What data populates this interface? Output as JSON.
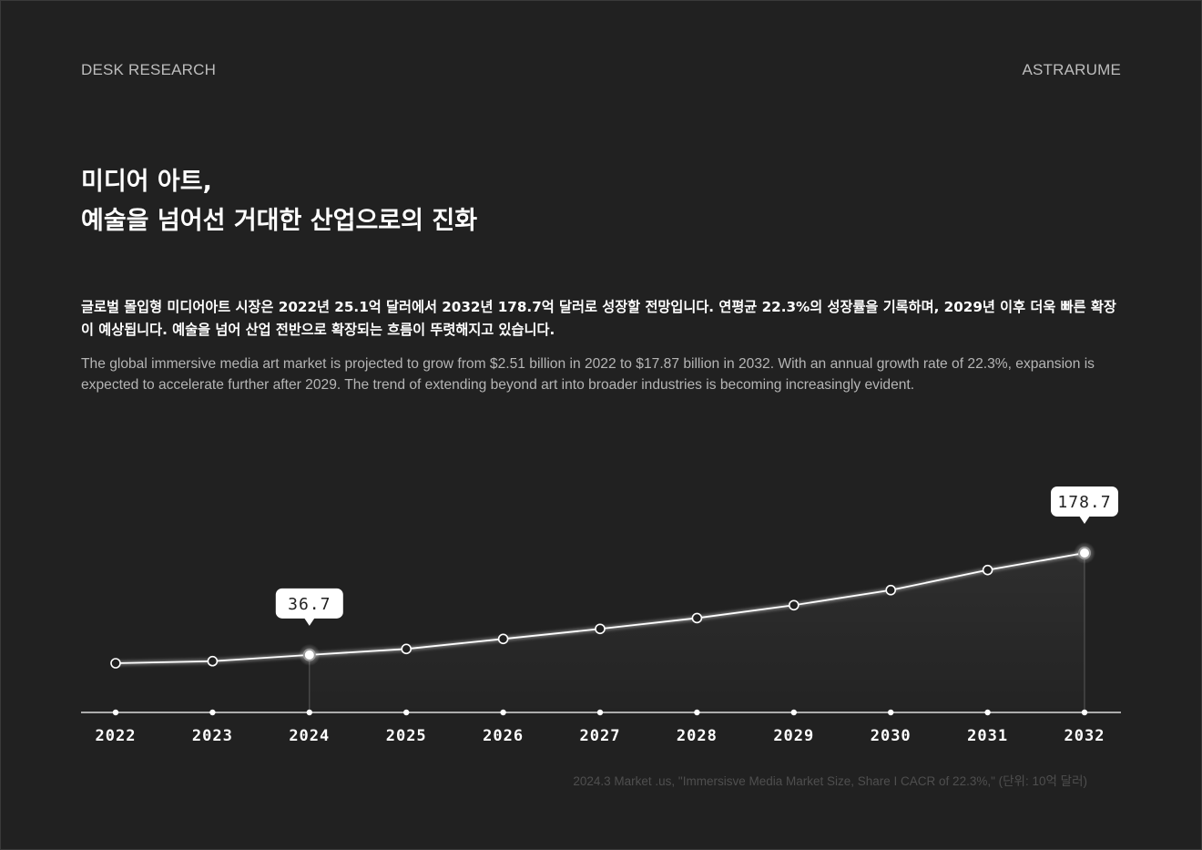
{
  "header": {
    "left_label": "DESK RESEARCH",
    "right_label": "ASTRARUME"
  },
  "title": {
    "line1": "미디어 아트,",
    "line2": "예술을 넘어선 거대한 산업으로의 진화"
  },
  "description": {
    "korean": "글로벌 몰입형 미디어아트 시장은 2022년 25.1억 달러에서 2032년 178.7억 달러로 성장할 전망입니다. 연평균 22.3%의 성장률을 기록하며, 2029년 이후 더욱 빠른 확장이 예상됩니다. 예술을 넘어 산업 전반으로 확장되는 흐름이 뚜렷해지고 있습니다.",
    "english": "The global immersive media art market is projected to grow from $2.51 billion in 2022 to $17.87 billion in 2032. With an annual growth rate of 22.3%, expansion is expected to accelerate further after 2029. The trend of extending beyond art into broader industries is becoming increasingly evident."
  },
  "source": "2024.3 Market .us, \"Immersisve Media Market Size, Share I CACR of 22.3%,\"   (단위: 10억 달러)",
  "colors": {
    "background": "#212121",
    "line": "#ffffff",
    "tick_label": "#ffffff",
    "callout_bg": "#ffffff",
    "callout_text": "#222222"
  },
  "chart_data": {
    "type": "line",
    "categories": [
      "2022",
      "2023",
      "2024",
      "2025",
      "2026",
      "2027",
      "2028",
      "2029",
      "2030",
      "2031",
      "2032"
    ],
    "values": [
      25.1,
      28.0,
      36.7,
      45.0,
      59.0,
      73.0,
      88.0,
      106.0,
      127.0,
      155.0,
      178.7
    ],
    "highlights": [
      {
        "category": "2024",
        "label": "36.7"
      },
      {
        "category": "2032",
        "label": "178.7"
      }
    ],
    "xlabel": "",
    "ylabel": "",
    "grid": false
  }
}
